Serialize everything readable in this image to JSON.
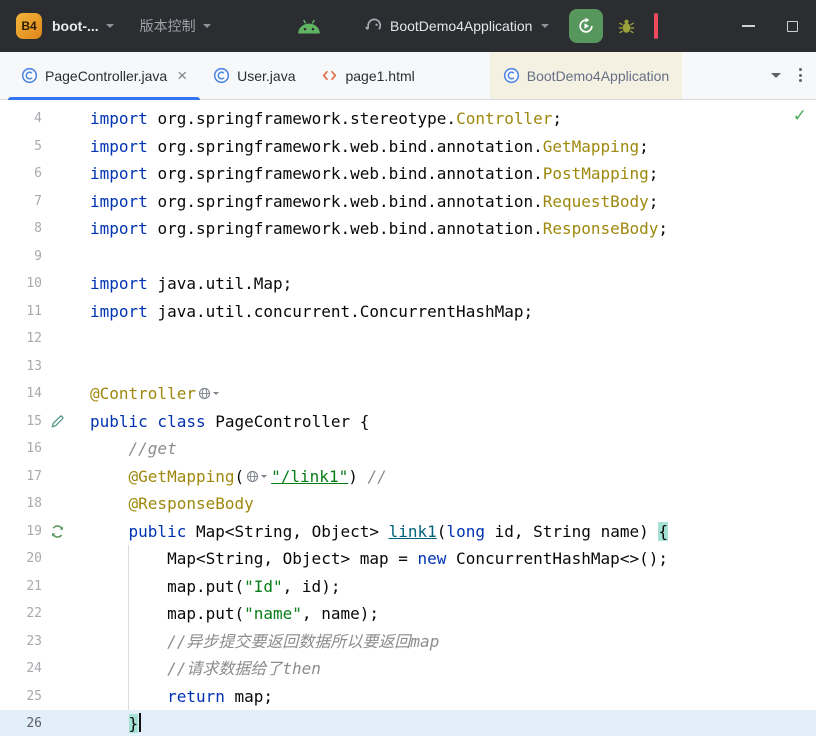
{
  "titlebar": {
    "logo_text": "B4",
    "project_name": "boot-...",
    "vcs_label": "版本控制",
    "run_config": "BootDemo4Application"
  },
  "tabbar": {
    "tabs": [
      {
        "label": "PageController.java",
        "type": "java-class",
        "state": "active"
      },
      {
        "label": "User.java",
        "type": "java-class",
        "state": "normal"
      },
      {
        "label": "page1.html",
        "type": "html",
        "state": "normal"
      },
      {
        "label": "BootDemo4Application",
        "type": "java-class",
        "state": "preview"
      }
    ]
  },
  "editor": {
    "inspection_status": "✓",
    "lines": [
      {
        "n": 4,
        "segs": [
          {
            "s": "kw",
            "t": "import "
          },
          {
            "s": "pl",
            "t": "org.springframework.stereotype."
          },
          {
            "s": "ann",
            "t": "Controller"
          },
          {
            "s": "pl",
            "t": ";"
          }
        ]
      },
      {
        "n": 5,
        "segs": [
          {
            "s": "kw",
            "t": "import "
          },
          {
            "s": "pl",
            "t": "org.springframework.web.bind.annotation."
          },
          {
            "s": "ann",
            "t": "GetMapping"
          },
          {
            "s": "pl",
            "t": ";"
          }
        ]
      },
      {
        "n": 6,
        "segs": [
          {
            "s": "kw",
            "t": "import "
          },
          {
            "s": "pl",
            "t": "org.springframework.web.bind.annotation."
          },
          {
            "s": "ann",
            "t": "PostMapping"
          },
          {
            "s": "pl",
            "t": ";"
          }
        ]
      },
      {
        "n": 7,
        "segs": [
          {
            "s": "kw",
            "t": "import "
          },
          {
            "s": "pl",
            "t": "org.springframework.web.bind.annotation."
          },
          {
            "s": "ann",
            "t": "RequestBody"
          },
          {
            "s": "pl",
            "t": ";"
          }
        ]
      },
      {
        "n": 8,
        "segs": [
          {
            "s": "kw",
            "t": "import "
          },
          {
            "s": "pl",
            "t": "org.springframework.web.bind.annotation."
          },
          {
            "s": "ann",
            "t": "ResponseBody"
          },
          {
            "s": "pl",
            "t": ";"
          }
        ]
      },
      {
        "n": 9,
        "segs": []
      },
      {
        "n": 10,
        "segs": [
          {
            "s": "kw",
            "t": "import "
          },
          {
            "s": "pl",
            "t": "java.util.Map;"
          }
        ]
      },
      {
        "n": 11,
        "segs": [
          {
            "s": "kw",
            "t": "import "
          },
          {
            "s": "pl",
            "t": "java.util.concurrent.ConcurrentHashMap;"
          }
        ]
      },
      {
        "n": 12,
        "segs": []
      },
      {
        "n": 13,
        "segs": []
      },
      {
        "n": 14,
        "segs": [
          {
            "s": "ann",
            "t": "@Controller"
          },
          {
            "s": "inlay"
          }
        ]
      },
      {
        "n": 15,
        "icon": "pen",
        "segs": [
          {
            "s": "kw",
            "t": "public class "
          },
          {
            "s": "pl",
            "t": "PageController {"
          }
        ]
      },
      {
        "n": 16,
        "segs": [
          {
            "s": "pl",
            "t": "    "
          },
          {
            "s": "com",
            "t": "//get"
          }
        ]
      },
      {
        "n": 17,
        "segs": [
          {
            "s": "pl",
            "t": "    "
          },
          {
            "s": "ann",
            "t": "@GetMapping"
          },
          {
            "s": "pl",
            "t": "("
          },
          {
            "s": "inlay"
          },
          {
            "s": "strl",
            "t": "\"/link1\""
          },
          {
            "s": "pl",
            "t": ") "
          },
          {
            "s": "com",
            "t": "//"
          }
        ]
      },
      {
        "n": 18,
        "segs": [
          {
            "s": "pl",
            "t": "    "
          },
          {
            "s": "ann",
            "t": "@ResponseBody"
          }
        ]
      },
      {
        "n": 19,
        "icon": "endpoint",
        "segs": [
          {
            "s": "pl",
            "t": "    "
          },
          {
            "s": "kw",
            "t": "public "
          },
          {
            "s": "pl",
            "t": "Map<String, Object> "
          },
          {
            "s": "mth",
            "t": "link1"
          },
          {
            "s": "pl",
            "t": "("
          },
          {
            "s": "kw",
            "t": "long"
          },
          {
            "s": "pl",
            "t": " id, String name) "
          },
          {
            "s": "brc",
            "t": "{"
          }
        ]
      },
      {
        "n": 20,
        "segs": [
          {
            "s": "pl",
            "t": "        Map<String, Object> map = "
          },
          {
            "s": "kw",
            "t": "new"
          },
          {
            "s": "pl",
            "t": " ConcurrentHashMap<>();"
          }
        ]
      },
      {
        "n": 21,
        "segs": [
          {
            "s": "pl",
            "t": "        map.put("
          },
          {
            "s": "str",
            "t": "\"Id\""
          },
          {
            "s": "pl",
            "t": ", id);"
          }
        ]
      },
      {
        "n": 22,
        "segs": [
          {
            "s": "pl",
            "t": "        map.put("
          },
          {
            "s": "str",
            "t": "\"name\""
          },
          {
            "s": "pl",
            "t": ", name);"
          }
        ]
      },
      {
        "n": 23,
        "segs": [
          {
            "s": "pl",
            "t": "        "
          },
          {
            "s": "com",
            "t": "//异步提交要返回数据所以要返回map"
          }
        ]
      },
      {
        "n": 24,
        "segs": [
          {
            "s": "pl",
            "t": "        "
          },
          {
            "s": "com",
            "t": "//请求数据给了then"
          }
        ]
      },
      {
        "n": 25,
        "segs": [
          {
            "s": "pl",
            "t": "        "
          },
          {
            "s": "kw",
            "t": "return"
          },
          {
            "s": "pl",
            "t": " map;"
          }
        ]
      },
      {
        "n": 26,
        "current": true,
        "segs": [
          {
            "s": "pl",
            "t": "    "
          },
          {
            "s": "brc",
            "t": "}"
          },
          {
            "s": "caret"
          }
        ]
      }
    ]
  },
  "colors": {
    "accent_blue": "#3574f0",
    "keyword": "#0033b3",
    "string": "#067d17",
    "annotation": "#9e880d",
    "comment": "#8c8c8c",
    "method": "#00627a",
    "run_green": "#57965c",
    "caret_row": "#e3eefb",
    "brace_match": "#a6e1d5",
    "titlebar_bg": "#2b2d30"
  }
}
